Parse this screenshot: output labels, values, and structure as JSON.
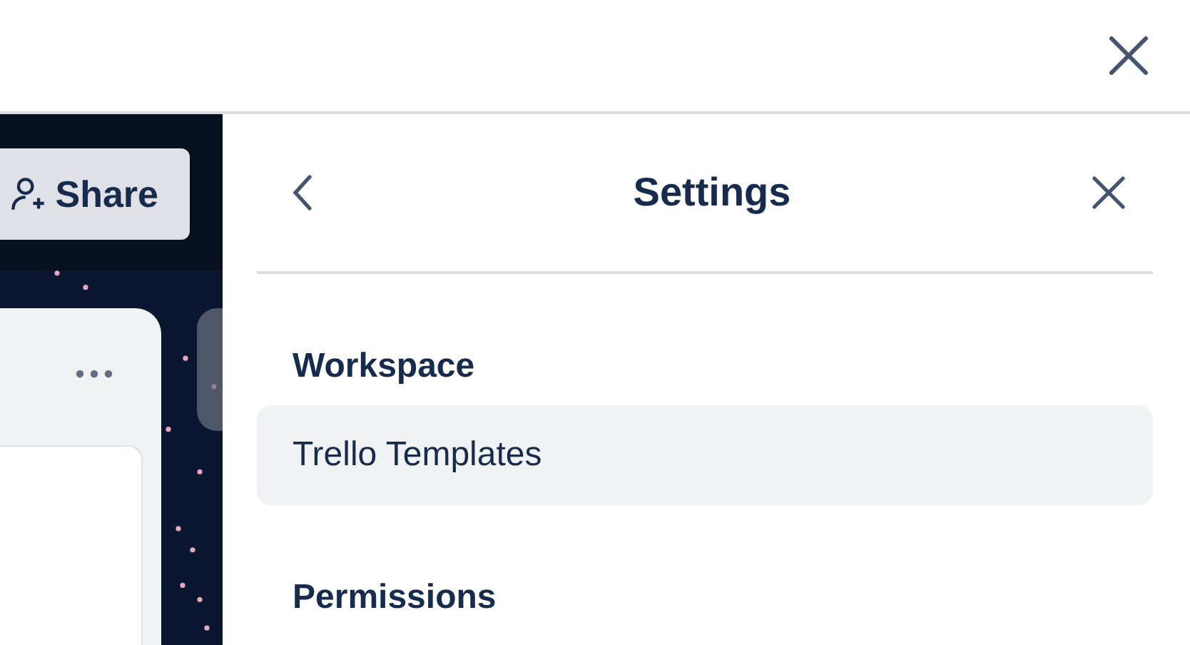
{
  "board": {
    "share_button": {
      "label": "Share"
    }
  },
  "panel": {
    "title": "Settings",
    "sections": [
      {
        "heading": "Workspace",
        "items": [
          {
            "label": "Trello Templates"
          }
        ]
      },
      {
        "heading": "Permissions"
      }
    ]
  }
}
